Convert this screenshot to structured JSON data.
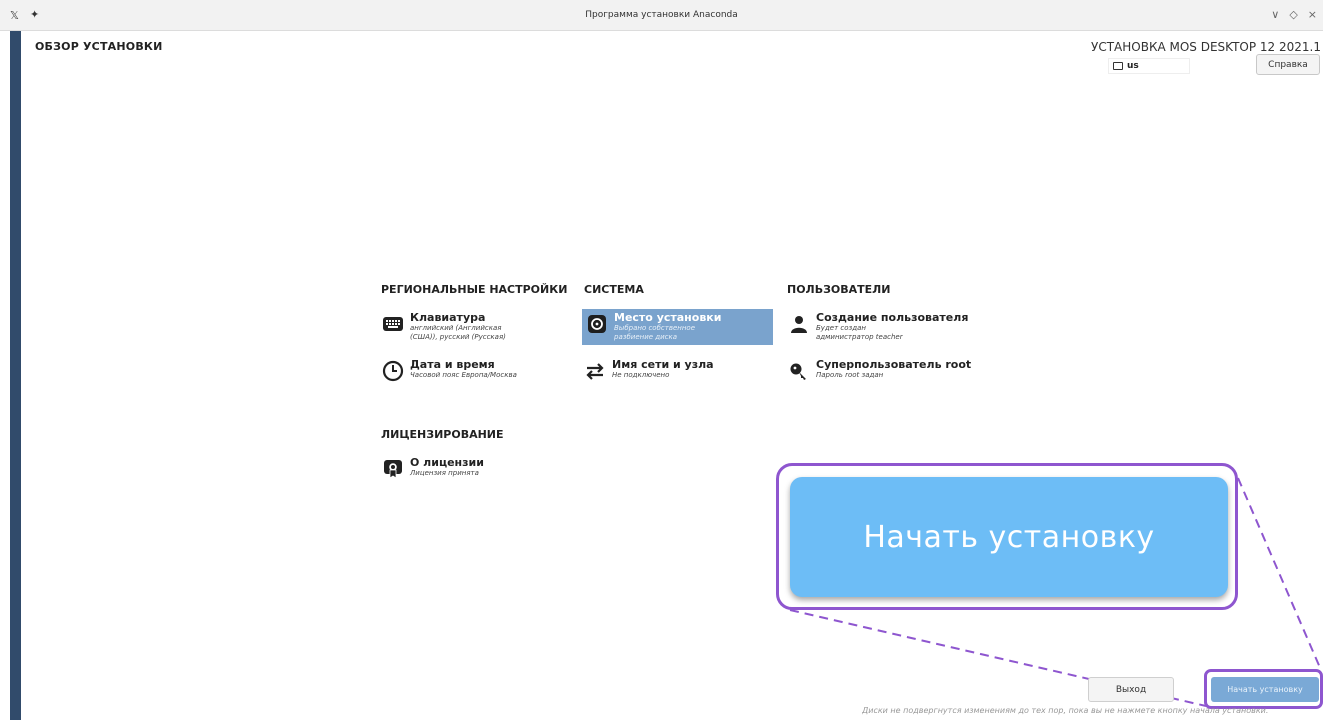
{
  "window": {
    "title": "Программа установки Anaconda",
    "controls": [
      "∨",
      "◇",
      "×"
    ]
  },
  "header": {
    "page_title": "ОБЗОР УСТАНОВКИ",
    "product_title": "УСТАНОВКА MOS DESKTOP 12 2021.1",
    "keyboard_layout": "us",
    "help_label": "Справка"
  },
  "categories": {
    "localization": "РЕГИОНАЛЬНЫЕ НАСТРОЙКИ",
    "system": "СИСТЕМА",
    "users": "ПОЛЬЗОВАТЕЛИ",
    "licensing": "ЛИЦЕНЗИРОВАНИЕ"
  },
  "spokes": {
    "keyboard": {
      "title": "Клавиатура",
      "status": "английский (Английская (США)), русский (Русская)",
      "icon": "keyboard-icon"
    },
    "datetime": {
      "title": "Дата и время",
      "status": "Часовой пояс Европа/Москва",
      "icon": "clock-icon"
    },
    "storage": {
      "title": "Место установки",
      "status": "Выбрано собственное разбиение диска",
      "icon": "hard-disk-icon"
    },
    "network": {
      "title": "Имя сети и узла",
      "status": "Не подключено",
      "icon": "network-arrows-icon"
    },
    "user": {
      "title": "Создание пользователя",
      "status": "Будет создан администратор teacher",
      "icon": "user-icon"
    },
    "root": {
      "title": "Суперпользователь root",
      "status": "Пароль root задан",
      "icon": "key-icon"
    },
    "license": {
      "title": "О лицензии",
      "status": "Лицензия принята",
      "icon": "license-icon"
    }
  },
  "callout": {
    "label": "Начать установку"
  },
  "footer": {
    "quit_label": "Выход",
    "begin_label": "Начать установку",
    "note": "Диски не подвергнутся изменениям до тех пор, пока вы не нажмете кнопку начала установки."
  },
  "colors": {
    "accent": "#8e56cf",
    "selected_spoke": "#7aa3cd",
    "callout_button": "#6dbdf6",
    "sidebar": "#314b6b"
  }
}
